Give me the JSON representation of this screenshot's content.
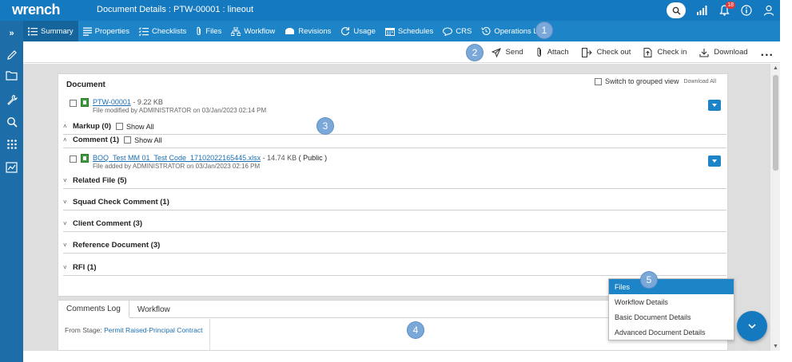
{
  "app": {
    "brand": "wrench",
    "title": "Document Details : PTW-00001 : lineout"
  },
  "topbar": {
    "notification_count": "18"
  },
  "rail": {
    "expand_label": "»"
  },
  "nav": {
    "tabs": [
      {
        "label": "Summary"
      },
      {
        "label": "Properties"
      },
      {
        "label": "Checklists"
      },
      {
        "label": "Files"
      },
      {
        "label": "Workflow"
      },
      {
        "label": "Revisions"
      },
      {
        "label": "Usage"
      },
      {
        "label": "Schedules"
      },
      {
        "label": "CRS"
      },
      {
        "label": "Operations Log"
      }
    ]
  },
  "steps": [
    "1",
    "2",
    "3",
    "4",
    "5"
  ],
  "actions": {
    "send": "Send",
    "attach": "Attach",
    "checkout": "Check out",
    "checkin": "Check in",
    "download": "Download",
    "more": "..."
  },
  "document": {
    "title": "Document",
    "grouped_label": "Switch to grouped view",
    "download_all": "Download All",
    "main_file": {
      "name": "PTW-00001",
      "size": " - 9.22 KB",
      "meta": "File modified by ADMINISTRATOR on 03/Jan/2023 02:14 PM"
    },
    "markup": {
      "label": "Markup (0)",
      "show_all": "Show All"
    },
    "comment": {
      "label": "Comment (1)",
      "show_all": "Show All",
      "file": {
        "name": "BOQ_Test MM 01_Test Code_17102022165445.xlsx",
        "size": " - 14.74 KB ",
        "visibility": "( Public )",
        "meta": "File added by ADMINISTRATOR on 03/Jan/2023 02:16 PM"
      }
    },
    "sections": [
      {
        "label": "Related File (5)"
      },
      {
        "label": "Squad Check Comment (1)"
      },
      {
        "label": "Client Comment (3)"
      },
      {
        "label": "Reference Document (3)"
      },
      {
        "label": "RFI (1)"
      }
    ]
  },
  "bottom": {
    "tabs": [
      {
        "label": "Comments Log"
      },
      {
        "label": "Workflow"
      }
    ],
    "from_stage_label": "From Stage: ",
    "from_stage_value": "Permit Raised-Principal Contract"
  },
  "menu": {
    "items": [
      {
        "label": "Files"
      },
      {
        "label": "Workflow Details"
      },
      {
        "label": "Basic Document Details"
      },
      {
        "label": "Advanced Document Details"
      }
    ]
  },
  "colors": {
    "topbar": "#1479bf",
    "navbar": "#1d84c7",
    "rail": "#1d6ea8",
    "accent": "#1a6fb5"
  }
}
